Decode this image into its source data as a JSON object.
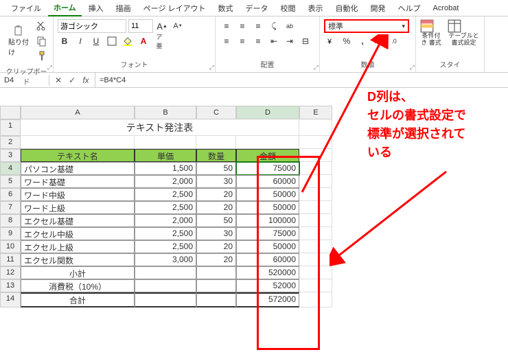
{
  "menu": {
    "items": [
      "ファイル",
      "ホーム",
      "挿入",
      "描画",
      "ページ レイアウト",
      "数式",
      "データ",
      "校閲",
      "表示",
      "自動化",
      "開発",
      "ヘルプ",
      "Acrobat"
    ],
    "active_index": 1
  },
  "ribbon": {
    "clipboard": {
      "paste_label": "貼り付け",
      "group_label": "クリップボード"
    },
    "font": {
      "name": "游ゴシック",
      "size": "11",
      "group_label": "フォント",
      "bold": "B",
      "italic": "I",
      "underline": "U"
    },
    "align": {
      "group_label": "配置",
      "wrap_label": "折り返し"
    },
    "number": {
      "format": "標準",
      "group_label": "数値"
    },
    "styles": {
      "cond_label": "条件付き\n書式",
      "table_label": "テーブルと\n書式設定",
      "group_label": "スタイ"
    }
  },
  "formula_bar": {
    "namebox": "D4",
    "formula": "=B4*C4"
  },
  "grid": {
    "cols": [
      "A",
      "B",
      "C",
      "D",
      "E"
    ],
    "title": "テキスト発注表",
    "headers": [
      "テキスト名",
      "単価",
      "数量",
      "金額"
    ],
    "rows": [
      {
        "name": "パソコン基礎",
        "price": "1,500",
        "qty": "50",
        "amount": "75000"
      },
      {
        "name": "ワード基礎",
        "price": "2,000",
        "qty": "30",
        "amount": "60000"
      },
      {
        "name": "ワード中級",
        "price": "2,500",
        "qty": "20",
        "amount": "50000"
      },
      {
        "name": "ワード上級",
        "price": "2,500",
        "qty": "20",
        "amount": "50000"
      },
      {
        "name": "エクセル基礎",
        "price": "2,000",
        "qty": "50",
        "amount": "100000"
      },
      {
        "name": "エクセル中級",
        "price": "2,500",
        "qty": "30",
        "amount": "75000"
      },
      {
        "name": "エクセル上級",
        "price": "2,500",
        "qty": "20",
        "amount": "50000"
      },
      {
        "name": "エクセル関数",
        "price": "3,000",
        "qty": "20",
        "amount": "60000"
      }
    ],
    "subtotal": {
      "label": "小計",
      "amount": "520000"
    },
    "tax": {
      "label": "消費税（10%）",
      "amount": "52000"
    },
    "total": {
      "label": "合計",
      "amount": "572000"
    }
  },
  "annotation": {
    "text1": "D列は、",
    "text2": "セルの書式設定で",
    "text3": "標準が選択されて",
    "text4": "いる"
  }
}
